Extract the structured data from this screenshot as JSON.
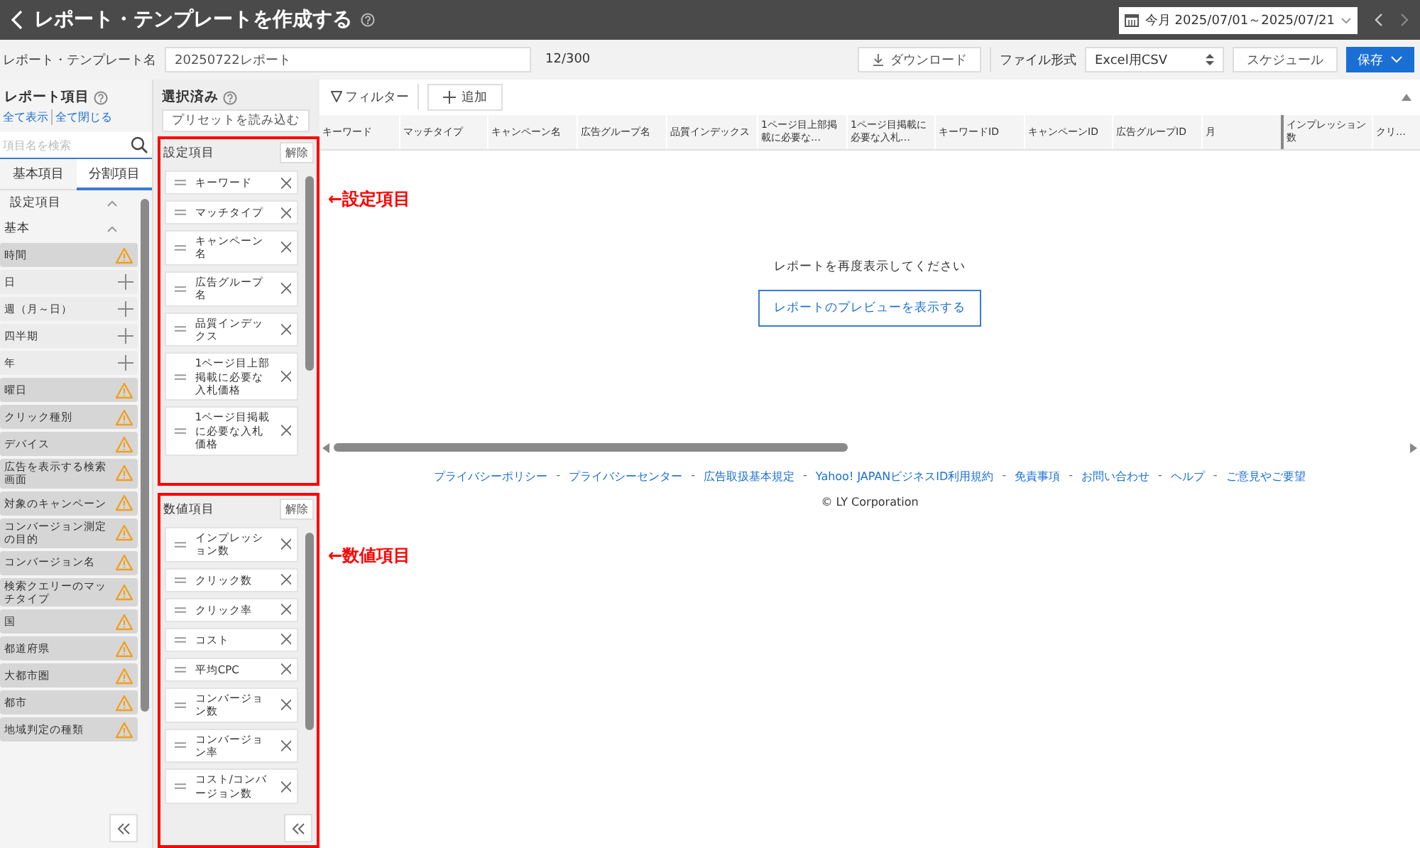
{
  "header": {
    "title": "レポート・テンプレートを作成する",
    "date_range": "今月 2025/07/01～2025/07/21"
  },
  "toolbar": {
    "name_label": "レポート・テンプレート名",
    "name_value": "20250722レポート",
    "char_count": "12/300",
    "download": "ダウンロード",
    "file_format_label": "ファイル形式",
    "file_format": "Excel用CSV",
    "schedule": "スケジュール",
    "save": "保存"
  },
  "report_items": {
    "title": "レポート項目",
    "show_all": "全て表示",
    "collapse_all": "全て閉じる",
    "search": {
      "placeholder": "項目名を検索"
    },
    "tabs": [
      {
        "label": "基本項目",
        "selected": false
      },
      {
        "label": "分割項目",
        "selected": true
      }
    ],
    "tree": [
      {
        "label": "設定項目",
        "expanded": true,
        "children": [
          {
            "label": "基本",
            "expanded": true,
            "children": [
              {
                "label": "時間",
                "kind": "warning"
              },
              {
                "label": "日",
                "kind": "add"
              },
              {
                "label": "週（月～日）",
                "kind": "add"
              },
              {
                "label": "四半期",
                "kind": "add"
              },
              {
                "label": "年",
                "kind": "add"
              },
              {
                "label": "曜日",
                "kind": "warning"
              },
              {
                "label": "クリック種別",
                "kind": "warning"
              },
              {
                "label": "デバイス",
                "kind": "warning"
              },
              {
                "label": "広告を表示する検索画面",
                "kind": "warning"
              },
              {
                "label": "対象のキャンペーン",
                "kind": "warning"
              },
              {
                "label": "コンバージョン測定の目的",
                "kind": "warning"
              },
              {
                "label": "コンバージョン名",
                "kind": "warning"
              },
              {
                "label": "検索クエリーのマッチタイプ",
                "kind": "warning"
              },
              {
                "label": "国",
                "kind": "warning"
              },
              {
                "label": "都道府県",
                "kind": "warning"
              },
              {
                "label": "大都市圏",
                "kind": "warning"
              },
              {
                "label": "都市",
                "kind": "warning"
              },
              {
                "label": "地域判定の種類",
                "kind": "warning"
              }
            ]
          }
        ]
      }
    ]
  },
  "selected": {
    "title": "選択済み",
    "preset_button": "プリセットを読み込む",
    "sections": [
      {
        "title": "設定項目",
        "clear": "解除",
        "annotation": "←設定項目",
        "items": [
          "キーワード",
          "マッチタイプ",
          "キャンペーン名",
          "広告グループ名",
          "品質インデックス",
          "1ページ目上部掲載に必要な入札価格",
          "1ページ目掲載に必要な入札価格"
        ]
      },
      {
        "title": "数値項目",
        "clear": "解除",
        "annotation": "←数値項目",
        "items": [
          "インプレッション数",
          "クリック数",
          "クリック率",
          "コスト",
          "平均CPC",
          "コンバージョン数",
          "コンバージョン率",
          "コスト/コンバージョン数"
        ]
      }
    ]
  },
  "table": {
    "filter": "フィルター",
    "add": "追加",
    "columns": [
      "キーワード",
      "マッチタイプ",
      "キャンペーン名",
      "広告グループ名",
      "品質インデックス",
      "1ページ目上部掲載に必要な…",
      "1ページ目掲載に必要な入札…",
      "キーワードID",
      "キャンペーンID",
      "広告グループID",
      "月",
      "インプレッション数",
      "クリ…"
    ],
    "message": "レポートを再度表示してください",
    "preview_button": "レポートのプレビューを表示する"
  },
  "footer": {
    "separator": "-",
    "links": [
      "プライバシーポリシー",
      "プライバシーセンター",
      "広告取扱基本規定",
      "Yahoo! JAPANビジネスID利用規約",
      "免責事項",
      "お問い合わせ",
      "ヘルプ",
      "ご意見やご要望"
    ],
    "copyright": "© LY Corporation"
  }
}
